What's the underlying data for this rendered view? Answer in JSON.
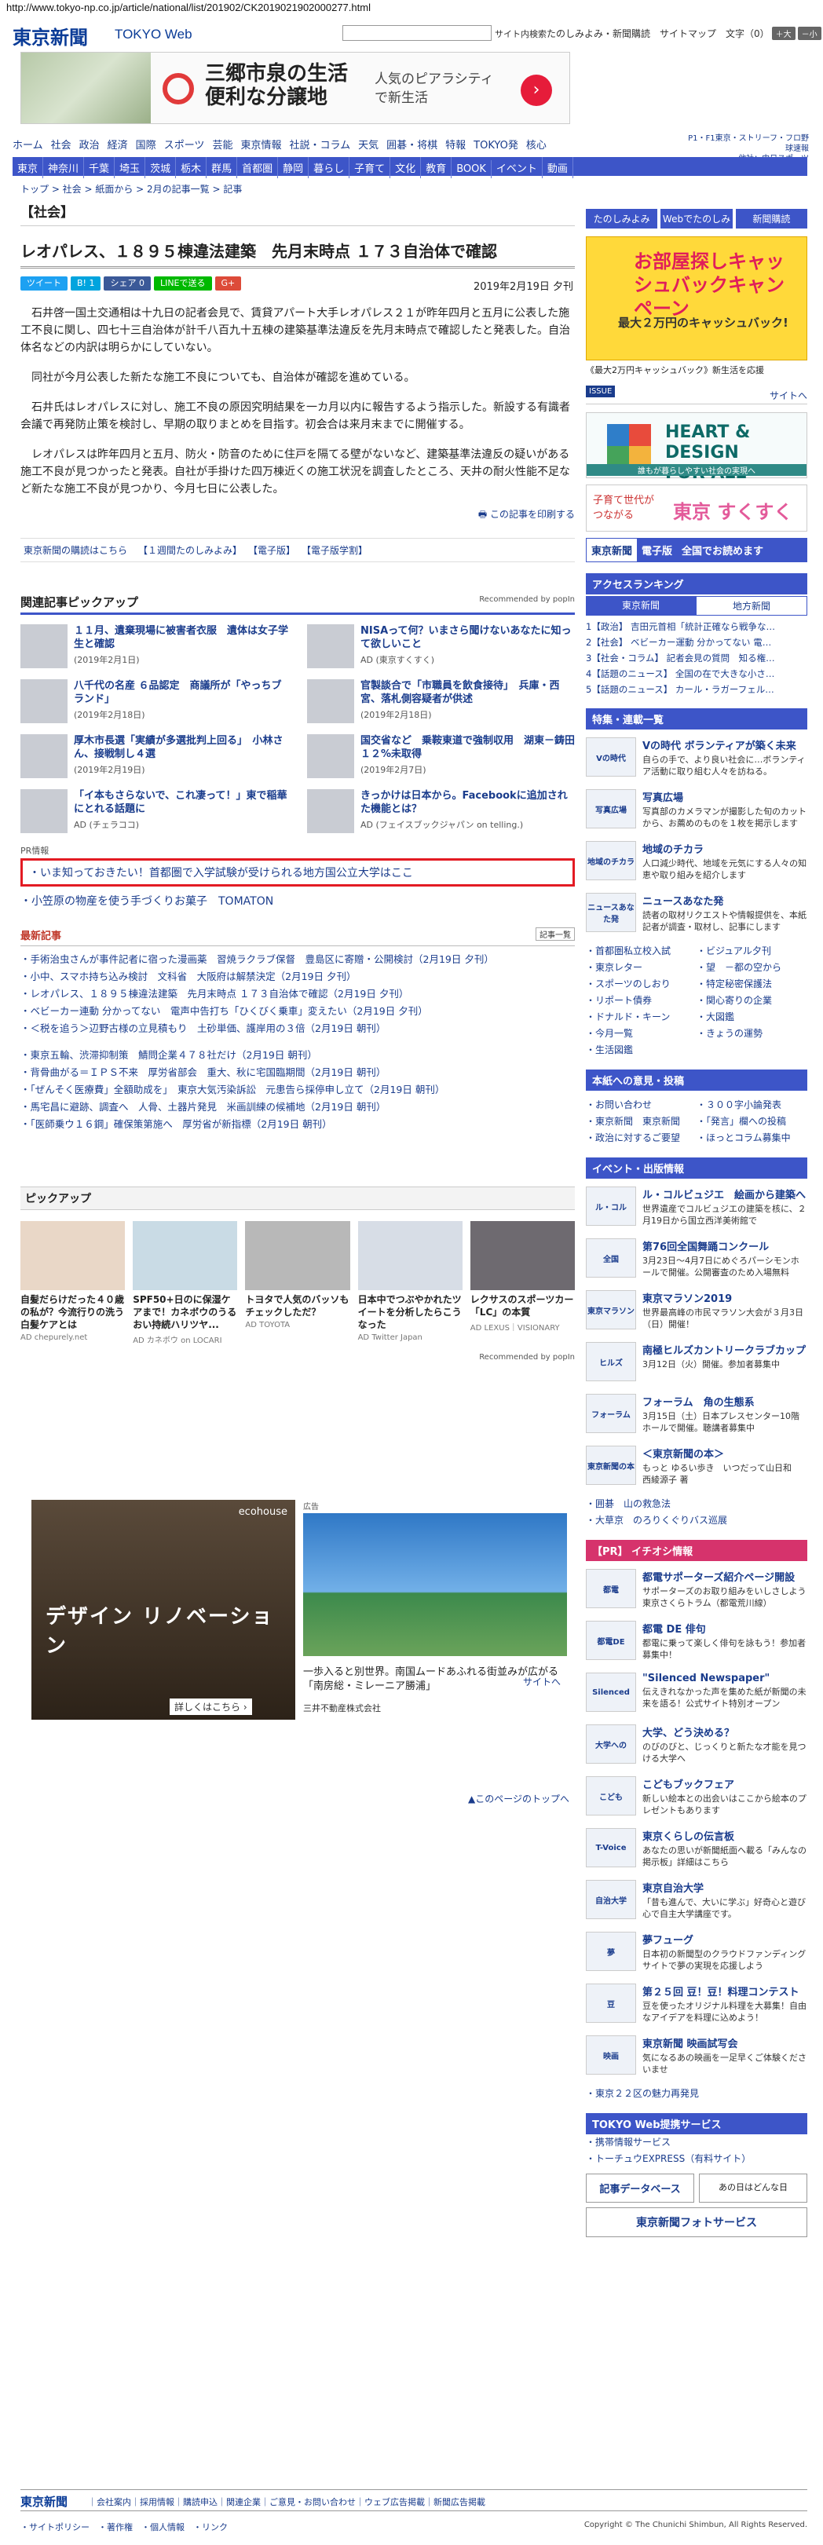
{
  "url": "http://www.tokyo-np.co.jp/article/national/list/201902/CK2019021902000277.html",
  "header": {
    "logo": "東京新聞",
    "logo_web": "TOKYO Web",
    "search_btn": "サイト内検索",
    "links": "たのしみよみ・新聞購読　サイトマップ　文字（0）",
    "font_big": "＋大",
    "font_small": "－小"
  },
  "ad_top": {
    "title": "三郷市泉の生活\n便利な分譲地",
    "sub": "人気のピアラシティ\nで新生活",
    "go": "›"
  },
  "nav_main": [
    "ホーム",
    "社会",
    "政治",
    "経済",
    "国際",
    "スポーツ",
    "芸能",
    "東京情報",
    "社説・コラム",
    "天気",
    "囲碁・将棋",
    "特報",
    "TOKYO発",
    "核心"
  ],
  "nav_right": "P1・F1東京・ストリーフ・フロ野球速報\n他社：中日スポーツ",
  "nav_sub": [
    "東京",
    "神奈川",
    "千葉",
    "埼玉",
    "茨城",
    "栃木",
    "群馬",
    "首都圏",
    "静岡",
    "暮らし",
    "子育て",
    "文化",
    "教育",
    "BOOK",
    "イベント",
    "動画"
  ],
  "breadcrumb": "トップ > 社会 > 紙面から > 2月の記事一覧 > 記事",
  "article": {
    "section": "【社会】",
    "title": "レオパレス、１８９５棟違法建築　先月末時点 １７３自治体で確認",
    "share": [
      "ツイート",
      "B! 1",
      "シェア 0",
      "LINEで送る",
      "G+"
    ],
    "date": "2019年2月19日 夕刊",
    "paras": [
      "石井啓一国土交通相は十九日の記者会見で、賃貸アパート大手レオパレス２１が昨年四月と五月に公表した施工不良に関し、四七十三自治体が計千八百九十五棟の建築基準法違反を先月末時点で確認したと発表した。自治体名などの内訳は明らかにしていない。",
      "同社が今月公表した新たな施工不良についても、自治体が確認を進めている。",
      "石井氏はレオパレスに対し、施工不良の原因究明結果を一カ月以内に報告するよう指示した。新設する有識者会議で再発防止策を検討し、早期の取りまとめを目指す。初会合は来月末までに開催する。",
      "レオパレスは昨年四月と五月、防火・防音のために住戸を隔てる壁がないなど、建築基準法違反の疑いがある施工不良が見つかったと発表。自社が手掛けた四万棟近くの施工状況を調査したところ、天井の耐火性能不足など新たな施工不良が見つかり、今月七日に公表した。"
    ],
    "print": "この記事を印刷する",
    "links": [
      "東京新聞の購読はこちら",
      "【１週間たのしみよみ】",
      "【電子版】",
      "【電子版学割】"
    ]
  },
  "related": {
    "heading": "関連記事ピックアップ",
    "powered": "Recommended by popIn",
    "items": [
      {
        "title": "１１月、遺棄現場に被害者衣服　遺体は女子学生と確認",
        "meta": "(2019年2月1日)"
      },
      {
        "title": "NISAって何？いまさら聞けないあなたに知って欲しいこと",
        "meta": "AD (東京すくすく)"
      },
      {
        "title": "八千代の名産 ６品認定　商議所が「やっちブランド」",
        "meta": "(2019年2月18日)"
      },
      {
        "title": "官製談合で「市職員を飲食接待」　兵庫・西宮、落札側容疑者が供述",
        "meta": "(2019年2月18日)"
      },
      {
        "title": "厚木市長選「実績が多選批判上回る」　小林さん、接戦制し４選",
        "meta": "(2019年2月19日)"
      },
      {
        "title": "国交省など　乗鞍東道で強制収用　湖東－鋳田　１２%未取得",
        "meta": "(2019年2月7日)"
      },
      {
        "title": "「イ本もさらないで、これ凄って！」東で稲華にとれる話題に",
        "meta": "AD (チェラココ)"
      },
      {
        "title": "きっかけは日本から。Facebookに追加された機能とは？",
        "meta": "AD (フェイスブックジャパン on telling.)"
      }
    ],
    "pr_head": "PR情報",
    "pr_box": "いま知っておきたい！首都圏で入学試験が受けられる地方国公立大学はここ",
    "pr2": "小笠原の物産を使う手づくりお菓子　TOMATON"
  },
  "latest": {
    "heading": "最新記事",
    "more": "記事一覧",
    "group1": [
      "手術治虫さんが事件記者に宿った漫画薬　習焼ラクラブ保督　豊島区に寄贈・公開検討（2月19日 夕刊）",
      "小中、スマホ持ち込み検討　文科省　大阪府は解禁決定（2月19日 夕刊）",
      "レオパレス、１８９５棟違法建築　先月末時点 １７３自治体で確認（2月19日 夕刊）",
      "ベビーカー連動 分かってない　電声中告打ち「ひくびく乗車」変えたい（2月19日 夕刊）",
      "＜税を追う＞辺野古様の立見積もり　土砂単価、護岸用の３倍（2月19日 朝刊）"
    ],
    "group2": [
      "東京五輪、渋滞抑制策　鯖問企業４７８社だけ（2月19日 朝刊）",
      "背骨曲がる＝ＩＰＳ不来　厚労省部会　重大、秋に宅国臨期間（2月19日 朝刊）",
      "「ぜんそく医療費」全額助成を」　東京大気汚染訴訟　元患告ら採停申し立て（2月19日 朝刊）",
      "馬宅昌に避跡、調査へ　人骨、土器片発見　米画訓練の候補地（2月19日 朝刊）",
      "「医師乗ウ１６鋼」確保策第施へ　厚労省が新指標（2月19日 朝刊）"
    ]
  },
  "pickup": {
    "heading": "ピックアップ",
    "items": [
      {
        "title": "自髪だらけだった４０歳の私が？今流行りの洗う白髪ケアとは",
        "ad": "AD chepurely.net"
      },
      {
        "title": "SPF50+日のに保湿ケアまで！カネボウのうるおい持続ハリツヤ...",
        "ad": "AD カネボウ on LOCARI"
      },
      {
        "title": "トヨタで人気のバッソもチェックしただ？",
        "ad": "AD TOYOTA"
      },
      {
        "title": "日本中でつぶやかれたツイートを分析したらこうなった",
        "ad": "AD Twitter Japan"
      },
      {
        "title": "レクサスのスポーツカー「LC」の本質",
        "ad": "AD LEXUS｜VISIONARY"
      }
    ],
    "powered": "Recommended by popIn"
  },
  "ad2": {
    "brand": "ecohouse",
    "text": "デザイン リノベーション",
    "detail": "詳しくはこちら ›"
  },
  "ad3": {
    "label": "広告",
    "text": "一歩入ると別世界。南国ムードあふれる街並みが広がる「南房総・ミレーニア勝浦」",
    "sponsor": "三井不動産株式会社",
    "go": "サイトへ"
  },
  "page_top": "▲このページのトップへ",
  "side": {
    "buttons": [
      "たのしみよみ",
      "Webでたのしみ",
      "新聞購読"
    ],
    "campaign": {
      "title": "お部屋探しキャッシュバックキャンペーン",
      "sub": "最大２万円のキャッシュバック!",
      "cap": "《最大2万円キャッシュバック》新生活を応援"
    },
    "gyo": {
      "label": "ISSUE",
      "r": "サイトへ"
    },
    "hd": {
      "title": "HEART & DESIGN\nFOR ALL",
      "sub": "誰もが暮らしやすい社会の実現へ"
    },
    "sukusuku": {
      "t": "子育て世代が\nつながる",
      "b": "東京 すくすく"
    },
    "tsh": {
      "a": "東京新聞",
      "b": "電子版",
      "c": "全国でお読めます"
    },
    "ranking": {
      "heading": "アクセスランキング",
      "tabs": [
        "東京新聞",
        "地方新聞"
      ],
      "items": [
        "1【政治】 吉田元首相「統計正確なら戦争な…",
        "2【社会】 ベビーカー運動 分かってない 電…",
        "3【社会・コラム】 記者会見の質問　知る権…",
        "4【話題のニュース】 全国の在で大きな小さ…",
        "5【話題のニュース】 カール・ラガーフェル…"
      ]
    },
    "feature": {
      "heading": "特集・連載一覧",
      "items": [
        {
          "icon": "Vの時代",
          "title": "Vの時代 ボランティアが築く未来",
          "desc": "自らの手で、より良い社会に…ボランティア活動に取り組む人々を訪ねる。"
        },
        {
          "icon": "写真広場",
          "title": "写真広場",
          "desc": "写真部のカメラマンが撮影した旬のカットから、お薦めのものを１枚を掲示します"
        },
        {
          "icon": "地域のチカラ",
          "title": "地域のチカラ",
          "desc": "人口減少時代、地域を元気にする人々の知恵や取り組みを紹介します"
        },
        {
          "icon": "ニュースあなた発",
          "title": "ニュースあなた発",
          "desc": "読者の取材リクエストや情報提供を、本紙記者が調査・取材し、記事にします"
        }
      ]
    },
    "links1": [
      "首都圏私立校入試",
      "ビジュアル夕刊",
      "東京レター",
      "望　－都の空から",
      "スポーツのしおり",
      "特定秘密保護法",
      "リポート債券",
      "関心寄りの企業",
      "ドナルド・キーン",
      "大図鑑",
      "今月一覧",
      "きょうの運勢",
      "生活図鑑"
    ],
    "info": {
      "heading": "本紙への意見・投稿",
      "items": [
        "お問い合わせ",
        "３００字小論発表",
        "東京新聞　東京新聞",
        "「発言」欄への投稿",
        "政治に対するご要望",
        "ほっとコラム募集中"
      ]
    },
    "event": {
      "heading": "イベント・出版情報",
      "items": [
        {
          "icon": "ル・コル",
          "title": "ル・コルビュジエ　絵画から建築へ",
          "desc": "世界遺産でコルビュジエの建築を核に、２月19日から国立西洋美術館で"
        },
        {
          "icon": "全国",
          "title": "第76回全国舞踊コンクール",
          "desc": "3月23日～4月7日にめぐろパーシモンホールで開催。公開審査のため入場無料"
        },
        {
          "icon": "東京マラソン",
          "title": "東京マラソン2019",
          "desc": "世界最高峰の市民マラソン大会が３月3日（日）開催！"
        },
        {
          "icon": "ヒルズ",
          "title": "南極ヒルズカントリークラブカップ",
          "desc": "3月12日（火）開催。参加者募集中"
        },
        {
          "icon": "フォーラム",
          "title": "フォーラム　角の生態系",
          "desc": "3月15日（土）日本プレスセンター10階ホールで開催。聴講者募集中"
        },
        {
          "icon": "東京新聞の本",
          "title": "＜東京新聞の本＞",
          "desc": "もっと ゆるい歩き　いつだって山日和　西綾源子 著"
        }
      ]
    },
    "links2": [
      "囲碁　山の救急法",
      "大草京　のろりくぐりバス巡展"
    ],
    "pr": {
      "heading": "【PR】 イチオシ情報",
      "items": [
        {
          "icon": "都電",
          "title": "都電サポーターズ紹介ページ開設",
          "desc": "サポーターズのお取り組みをいしさしよう東京さくらトラム（都電荒川線）"
        },
        {
          "icon": "都電DE",
          "title": "都電 DE 俳句",
          "desc": "都電に乗って楽しく俳句を詠もう！参加者募集中！"
        },
        {
          "icon": "Silenced",
          "title": "\"Silenced Newspaper\"",
          "desc": "伝えきれなかった声を集めた紙が新聞の未来を語る！公式サイト特別オープン"
        },
        {
          "icon": "大学への",
          "title": "大学、どう決める？",
          "desc": "のびのびと、じっくりと新たな才能を見つける大学へ"
        },
        {
          "icon": "こども",
          "title": "こどもブックフェア",
          "desc": "新しい絵本との出会いはここから絵本のプレゼントもあります"
        },
        {
          "icon": "T-Voice",
          "title": "東京くらしの伝言板",
          "desc": "あなたの思いが新聞紙面へ載る「みんなの掲示板」詳細はこちら"
        },
        {
          "icon": "自治大学",
          "title": "東京自治大学",
          "desc": "「昔も進んで、大いに学ぶ」好奇心と遊び心で自主大学講座です。"
        },
        {
          "icon": "夢",
          "title": "夢フューグ",
          "desc": "日本初の新聞型のクラウドファンディングサイトで夢の実現を応援しよう"
        },
        {
          "icon": "豆",
          "title": "第２５回 豆！豆！料理コンテスト",
          "desc": "豆を使ったオリジナル料理を大募集！自由なアイデアを料理に込めよう！"
        },
        {
          "icon": "映画",
          "title": "東京新聞 映画試写会",
          "desc": "気になるあの映画を一足早くご体験くださいませ"
        }
      ]
    },
    "links3": [
      "東京２２区の魅力再発見"
    ],
    "service": {
      "heading": "TOKYO Web提携サービス",
      "items": [
        "携帯情報サービス",
        "トーチュウEXPRESS（有料サイト）"
      ],
      "b1": "記事データベース",
      "b2": "あの日はどんな日",
      "b3": "東京新聞フォトサービス"
    }
  },
  "footer": {
    "logo": "東京新聞",
    "links": "｜会社案内｜採用情報｜購読申込｜関連企業｜ご意見・お問い合わせ｜ウェブ広告掲載｜新聞広告掲載",
    "sub": "・サイトポリシー　・著作権　・個人情報　・リンク",
    "copy": "Copyright © The Chunichi Shimbun, All Rights Reserved."
  }
}
